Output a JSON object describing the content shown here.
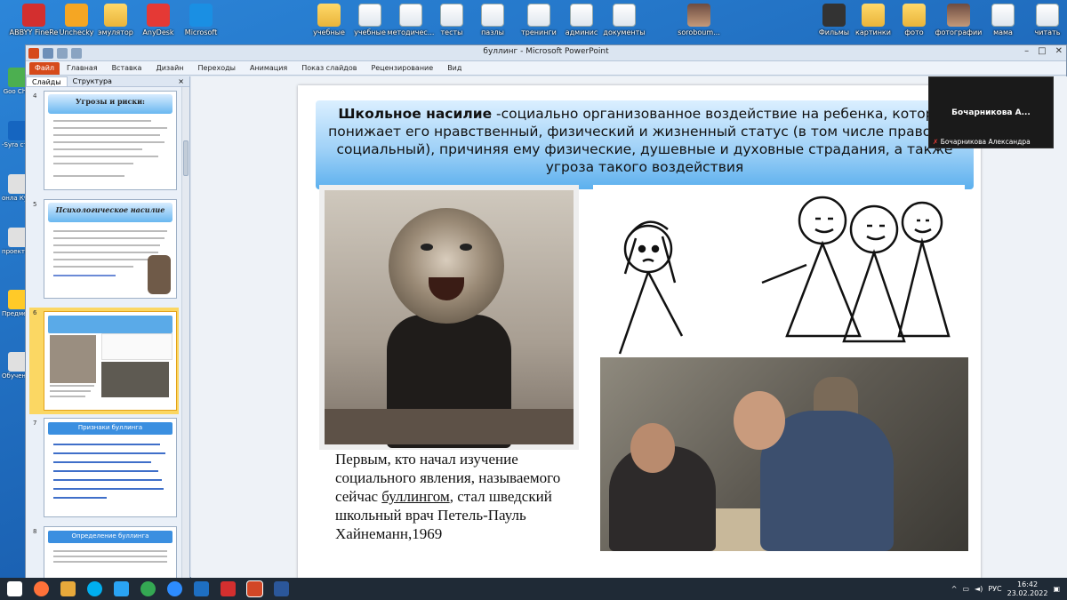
{
  "desktop_top": [
    {
      "label": "ABBYY FineRe",
      "kind": "app",
      "color": "#d32f2f"
    },
    {
      "label": "Unchecky",
      "kind": "app",
      "color": "#f5a623"
    },
    {
      "label": "эмулятор",
      "kind": "folder"
    },
    {
      "label": "AnyDesk",
      "kind": "app",
      "color": "#e53935"
    },
    {
      "label": "Microsoft",
      "kind": "app",
      "color": "#1a8fe3"
    },
    {
      "label": "учебные",
      "kind": "folder"
    },
    {
      "label": "учебные",
      "kind": "file"
    },
    {
      "label": "методичес...",
      "kind": "file"
    },
    {
      "label": "тесты",
      "kind": "file"
    },
    {
      "label": "пазлы",
      "kind": "file"
    },
    {
      "label": "тренинги",
      "kind": "file"
    },
    {
      "label": "админис",
      "kind": "file"
    },
    {
      "label": "документы",
      "kind": "file"
    },
    {
      "label": "soroboum...",
      "kind": "photo"
    },
    {
      "label": "Фильмы",
      "kind": "app",
      "color": "#333"
    },
    {
      "label": "картинки",
      "kind": "folder"
    },
    {
      "label": "фото",
      "kind": "folder"
    },
    {
      "label": "фотографии",
      "kind": "photo"
    },
    {
      "label": "мама",
      "kind": "file"
    },
    {
      "label": "читать",
      "kind": "file"
    }
  ],
  "desktop_left": [
    {
      "label": "Goo Chro",
      "color": "#4caf50"
    },
    {
      "label": "-Syra стол",
      "color": "#1565c0"
    },
    {
      "label": "онла Курс",
      "color": "#e0e0e0"
    },
    {
      "label": "проекти Ярль",
      "color": "#e0e0e0"
    },
    {
      "label": "Предмет Ярль",
      "color": "#ffca28"
    },
    {
      "label": "Обучен булли",
      "color": "#e0e0e0"
    }
  ],
  "window": {
    "title": "буллинг - Microsoft PowerPoint",
    "file_tab": "Файл",
    "tabs": [
      "Главная",
      "Вставка",
      "Дизайн",
      "Переходы",
      "Анимация",
      "Показ слайдов",
      "Рецензирование",
      "Вид"
    ]
  },
  "pane": {
    "tabs": [
      "Слайды",
      "Структура"
    ],
    "close": "×",
    "slides": [
      {
        "num": "4",
        "title": "Угрозы и риски:"
      },
      {
        "num": "5",
        "title": "Психологическое насилие"
      },
      {
        "num": "6",
        "title": ""
      },
      {
        "num": "7",
        "title": "Признаки буллинга"
      },
      {
        "num": "8",
        "title": "Определение буллинга"
      }
    ]
  },
  "slide": {
    "term": "Школьное насилие",
    "definition": " -социально организованное воздействие на ребенка, которое понижает его нравственный, физический и жизненный статус (в том числе правовой, социальный), причиняя ему физические, душевные и духовные страдания, а также угроза такого воздействия",
    "caption_1": "Первым, кто начал изучение социального явления, называемого сейчас ",
    "caption_u": "буллингом",
    "caption_2": ", стал шведский школьный врач Петель-Пауль Хайнеманн,1969"
  },
  "zoom": {
    "name": "Бочарникова А...",
    "footer": "Бочарникова Александра"
  },
  "taskbar": {
    "lang": "РУС",
    "time": "16:42",
    "date": "23.02.2022"
  }
}
